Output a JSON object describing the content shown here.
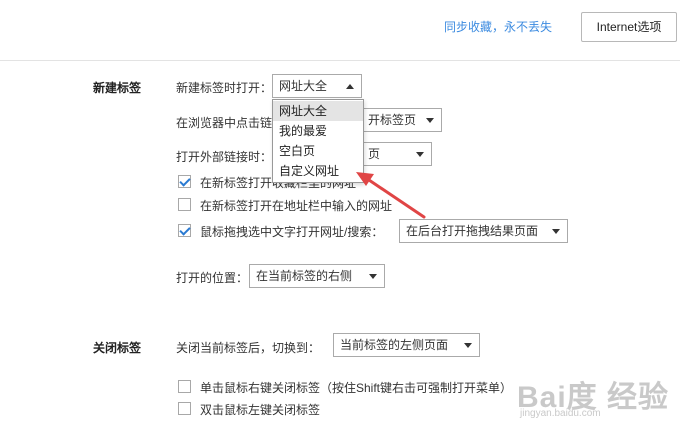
{
  "header": {
    "sync_link": "同步收藏，永不丢失",
    "internet_button": "Internet选项"
  },
  "new_tab": {
    "section_label": "新建标签",
    "open_label": "新建标签时打开：",
    "open_value": "网址大全",
    "open_options": [
      "网址大全",
      "我的最爱",
      "空白页",
      "自定义网址"
    ],
    "click_link_label": "在浏览器中点击链",
    "click_link_value": "开标签页",
    "external_label": "打开外部链接时：",
    "external_value": "页",
    "cb1_label": "在新标签打开收藏栏里的网址",
    "cb1_checked": true,
    "cb2_label": "在新标签打开在地址栏中输入的网址",
    "cb2_checked": false,
    "cb3_label": "鼠标拖拽选中文字打开网址/搜索：",
    "cb3_checked": true,
    "drag_value": "在后台打开拖拽结果页面",
    "position_label": "打开的位置：",
    "position_value": "在当前标签的右侧"
  },
  "close_tab": {
    "section_label": "关闭标签",
    "switch_label": "关闭当前标签后，切换到：",
    "switch_value": "当前标签的左侧页面",
    "cb4_label": "单击鼠标右键关闭标签（按住Shift键右击可强制打开菜单）",
    "cb4_checked": false,
    "cb5_label": "双击鼠标左键关闭标签",
    "cb5_checked": false
  },
  "watermark": {
    "main": "Bai度 经验",
    "sub": "jingyan.baidu.com"
  },
  "colors": {
    "link": "#3c8be0",
    "arrow": "#e04545",
    "check": "#2a7ad2"
  }
}
